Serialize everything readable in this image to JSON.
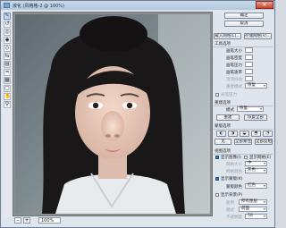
{
  "window": {
    "title": "液化 (风格格-2 @ 100%)",
    "close_label": "✕"
  },
  "toolbar": {
    "tools": [
      "forward-warp",
      "reconstruct",
      "twirl",
      "pucker",
      "bloat",
      "push-left",
      "mirror",
      "turbulence",
      "freeze-mask",
      "thaw-mask",
      "hand",
      "zoom"
    ]
  },
  "status": {
    "zoom": "100%",
    "minus": "–",
    "plus": "+"
  },
  "panel": {
    "ok": "确定",
    "cancel": "取消",
    "load_mesh": "载入网格(L)...",
    "save_mesh": "存储网格(V)...",
    "tool_options": "工具选项",
    "brush_size": "画笔大小",
    "brush_density": "画笔密度",
    "brush_pressure": "画笔压力",
    "brush_rate": "画笔速率",
    "turbulent_jitter": "湍流抖动",
    "reconstruct_mode": "重建模式",
    "reconstruct_mode_value": "恢复",
    "stylus_pressure": "光笔压力",
    "reconstruct_options": "重建选项",
    "mode": "模式",
    "mode_value": "恢复",
    "reconstruct": "重建",
    "restore_all": "恢复全部",
    "mask_options": "蒙版选项",
    "none": "无",
    "mask_all": "全部蒙住",
    "invert_all": "全部反相",
    "view_options": "视图选项",
    "show_image": "显示图像(I)",
    "show_mesh": "显示网格(E)",
    "mesh_size": "网格大小",
    "mesh_size_value": "中",
    "mesh_color": "网格颜色",
    "mesh_color_value": "灰色",
    "show_mask": "显示蒙版(K)",
    "mask_color": "蒙版颜色",
    "mask_color_value": "红色",
    "show_backdrop": "显示背景(P)",
    "use": "使用",
    "use_value": "所有图层",
    "backdrop_mode": "模式",
    "backdrop_mode_value": "前面",
    "opacity": "不透明度",
    "opacity_value": "50"
  }
}
